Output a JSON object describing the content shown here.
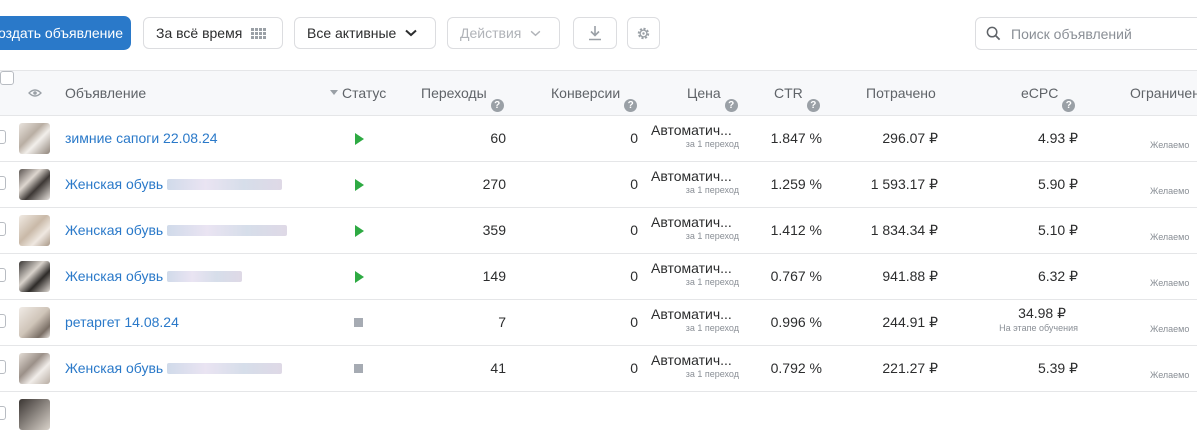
{
  "toolbar": {
    "create_label": "оздать объявление",
    "period_label": "За всё время",
    "filter_label": "Все активные",
    "actions_label": "Действия",
    "search_placeholder": "Поиск объявлений"
  },
  "icons": [
    "calendar-grid-icon",
    "chevron-down-icon",
    "download-icon",
    "gear-icon",
    "search-icon",
    "eye-icon",
    "sort-arrow-icon",
    "help-icon",
    "play-icon",
    "stop-icon"
  ],
  "colors": {
    "accent": "#2a79c9",
    "status_active": "#2eaa43",
    "status_stopped": "#a6abb3"
  },
  "table": {
    "headers": {
      "ad": "Объявление",
      "status": "Статус",
      "clicks": "Переходы",
      "conversions": "Конверсии",
      "price": "Цена",
      "ctr": "CTR",
      "spent": "Потрачено",
      "ecpc": "eCPC",
      "limit": "Ограничен"
    },
    "rows": [
      {
        "name": "зимние сапоги 22.08.24",
        "status": "active",
        "clicks": "60",
        "conversions": "0",
        "price": "Автоматич...",
        "price_note": "за 1 переход",
        "ctr": "1.847 %",
        "spent": "296.07 ₽",
        "ecpc": "4.93 ₽",
        "ecpc_note": "",
        "limit_note": "Желаемо"
      },
      {
        "name": "Женская обувь",
        "status": "active",
        "clicks": "270",
        "conversions": "0",
        "price": "Автоматич...",
        "price_note": "за 1 переход",
        "ctr": "1.259 %",
        "spent": "1 593.17 ₽",
        "ecpc": "5.90 ₽",
        "ecpc_note": "",
        "limit_note": "Желаемо"
      },
      {
        "name": "Женская обувь",
        "status": "active",
        "clicks": "359",
        "conversions": "0",
        "price": "Автоматич...",
        "price_note": "за 1 переход",
        "ctr": "1.412 %",
        "spent": "1 834.34 ₽",
        "ecpc": "5.10 ₽",
        "ecpc_note": "",
        "limit_note": "Желаемо"
      },
      {
        "name": "Женская обувь",
        "status": "active",
        "clicks": "149",
        "conversions": "0",
        "price": "Автоматич...",
        "price_note": "за 1 переход",
        "ctr": "0.767 %",
        "spent": "941.88 ₽",
        "ecpc": "6.32 ₽",
        "ecpc_note": "",
        "limit_note": "Желаемо"
      },
      {
        "name": "ретаргет 14.08.24",
        "status": "stopped",
        "clicks": "7",
        "conversions": "0",
        "price": "Автоматич...",
        "price_note": "за 1 переход",
        "ctr": "0.996 %",
        "spent": "244.91 ₽",
        "ecpc": "34.98 ₽",
        "ecpc_note": "На этапе обучения",
        "limit_note": "Желаемо"
      },
      {
        "name": "Женская обувь",
        "status": "stopped",
        "clicks": "41",
        "conversions": "0",
        "price": "Автоматич...",
        "price_note": "за 1 переход",
        "ctr": "0.792 %",
        "spent": "221.27 ₽",
        "ecpc": "5.39 ₽",
        "ecpc_note": "",
        "limit_note": "Желаемо"
      }
    ]
  }
}
